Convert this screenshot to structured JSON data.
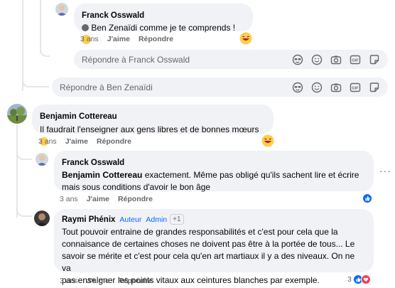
{
  "comments": [
    {
      "author": "Franck Osswald",
      "mention": "Ben Zenaïdi",
      "text": "comme je te comprends !",
      "time": "3 ans",
      "like": "J'aime",
      "reply": "Répondre"
    },
    {
      "author": "Benjamin Cottereau",
      "text": "Il faudrait l'enseigner aux gens libres et de bonnes mœurs",
      "time": "3 ans",
      "like": "J'aime",
      "reply": "Répondre"
    },
    {
      "author": "Franck Osswald",
      "mention": "Benjamin Cottereau",
      "text_line1": "exactement. Même pas obligé qu'ils sachent lire et écrire",
      "text_line2": "mais sous conditions d'avoir le bon âge",
      "time": "3 ans",
      "like": "J'aime",
      "reply": "Répondre",
      "more": "···"
    },
    {
      "author": "Raymi Phénix",
      "badge1": "Auteur",
      "badge2": "Admin",
      "badge3": "+1",
      "lines": [
        "Tout pouvoir entraine de grandes responsabilités et c'est pour cela que la",
        "connaisance de certaines choses ne doivent pas être à la portée de tous... Le",
        "savoir se mérite et c'est pour cela qu'en art martiaux il y a des niveaux. On ne va",
        "pas enseigner les points vitaux aux ceintures blanches par exemple."
      ],
      "time": "3 ans",
      "like": "J'aime",
      "reply": "Répondre",
      "reaction_count": "3"
    }
  ],
  "reply_boxes": [
    {
      "placeholder": "Répondre à Franck Osswald"
    },
    {
      "placeholder": "Répondre à Ben Zenaïdi"
    }
  ],
  "icons": {
    "reply_box": [
      "avatar-sticker-icon",
      "emoji-icon",
      "camera-icon",
      "gif-icon",
      "sticker-icon"
    ],
    "reactions": [
      "like-icon",
      "love-icon"
    ]
  },
  "colors": {
    "like_blue": "#0866ff",
    "love_red": "#f33e58",
    "bubble_bg": "#f0f2f5",
    "meta_gray": "#65676b"
  }
}
